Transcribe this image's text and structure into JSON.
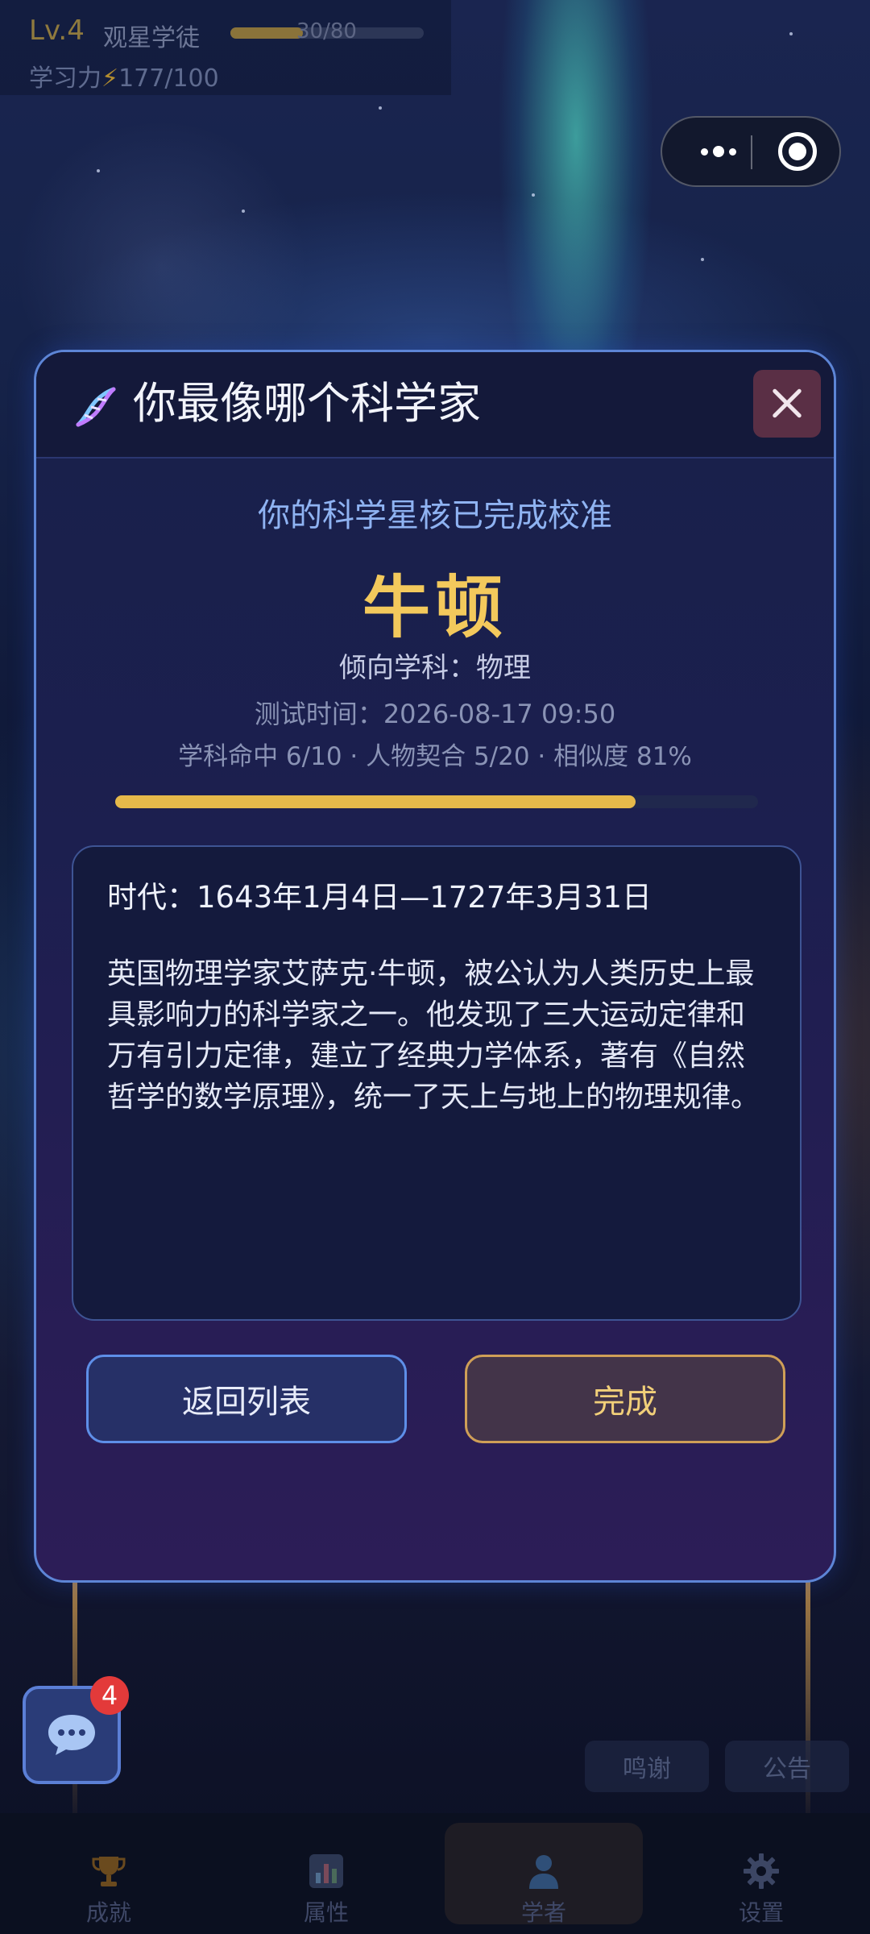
{
  "hud": {
    "level": "Lv.4",
    "rank": "观星学徒",
    "xp_text": "30/80",
    "xp_fraction": 0.375,
    "stamina_label": "学习力",
    "stamina_icon": "⚡",
    "stamina_value": "177/100"
  },
  "capsule": {
    "more_icon": "more-dots-icon",
    "target_icon": "target-icon"
  },
  "modal": {
    "title": "你最像哪个科学家",
    "subtitle": "你的科学星核已完成校准",
    "scientist_name": "牛顿",
    "discipline": "倾向学科：物理",
    "test_time": "测试时间：2026-08-17 09:50",
    "stats": "学科命中 6/10 · 人物契合 5/20 · 相似度 81%",
    "similarity_fraction": 0.81,
    "era": "时代：1643年1月4日—1727年3月31日",
    "description": "英国物理学家艾萨克·牛顿，被公认为人类历史上最具影响力的科学家之一。他发现了三大运动定律和万有引力定律，建立了经典力学体系，著有《自然哲学的数学原理》，统一了天上与地上的物理规律。",
    "back_button": "返回列表",
    "done_button": "完成"
  },
  "chat": {
    "badge": "4"
  },
  "pills": {
    "thanks": "鸣谢",
    "notice": "公告"
  },
  "nav": [
    {
      "label": "成就",
      "icon": "trophy-icon"
    },
    {
      "label": "属性",
      "icon": "bar-chart-icon"
    },
    {
      "label": "学者",
      "icon": "person-icon"
    },
    {
      "label": "设置",
      "icon": "gear-icon"
    }
  ],
  "colors": {
    "accent_gold": "#e6b94a",
    "accent_blue": "#5e8fe8",
    "badge_red": "#e33a3a"
  }
}
